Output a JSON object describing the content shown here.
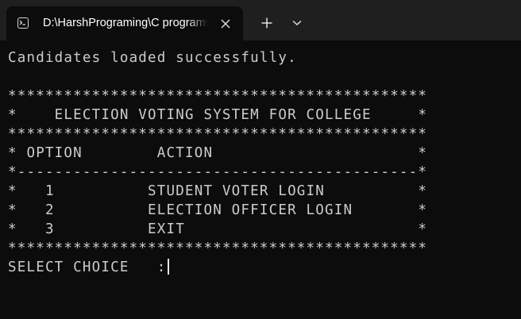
{
  "tab": {
    "icon": "terminal-icon",
    "title": "D:\\HarshPrograming\\C programs",
    "close_icon": "close-icon"
  },
  "titlebar": {
    "new_tab_icon": "plus-icon",
    "dropdown_icon": "chevron-down-icon"
  },
  "terminal": {
    "lines": [
      "Candidates loaded successfully.",
      "",
      "*********************************************",
      "*    ELECTION VOTING SYSTEM FOR COLLEGE     *",
      "*********************************************",
      "* OPTION        ACTION                      *",
      "*-------------------------------------------*",
      "*   1          STUDENT VOTER LOGIN          *",
      "*   2          ELECTION OFFICER LOGIN       *",
      "*   3          EXIT                         *",
      "*********************************************"
    ],
    "prompt": "SELECT CHOICE   :"
  }
}
